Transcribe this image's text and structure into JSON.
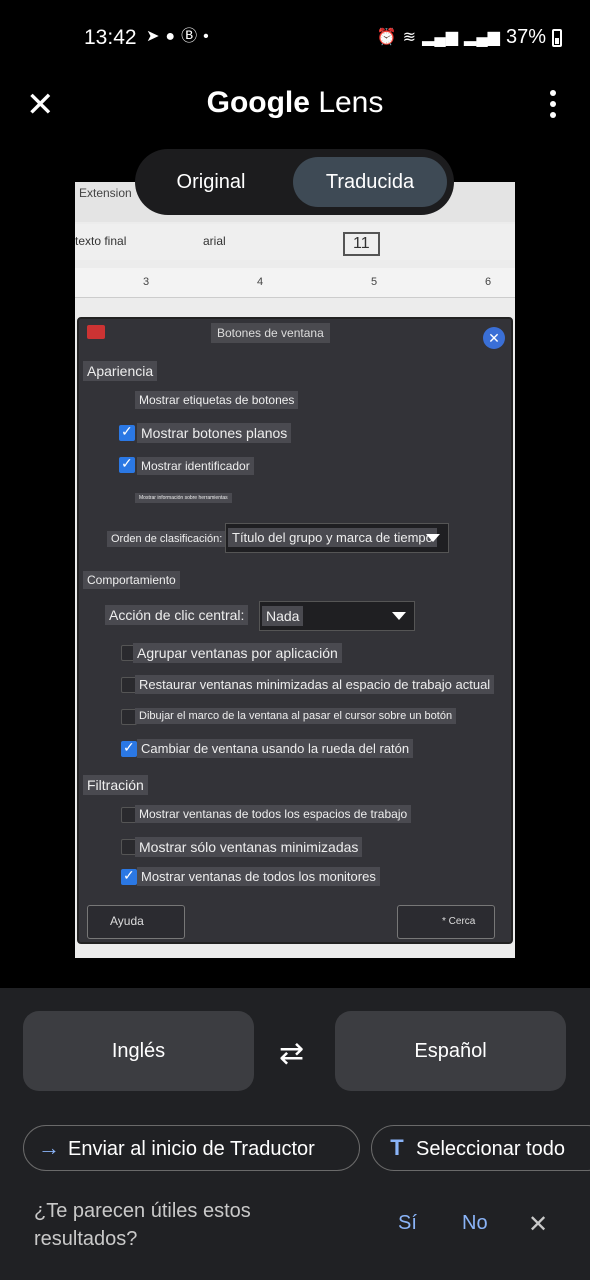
{
  "status_bar": {
    "time": "13:42",
    "battery": "37%",
    "left_icons": [
      "telegram-icon",
      "chat-icon",
      "b-icon",
      "dot-icon"
    ],
    "right_icons": [
      "alarm-icon",
      "wifi-icon",
      "signal-icon",
      "signal-icon",
      "battery-icon"
    ]
  },
  "header": {
    "title_brand": "Google",
    "title_product": "Lens"
  },
  "view_toggle": {
    "options": [
      "Original",
      "Traducida"
    ],
    "selected": "Traducida"
  },
  "photo": {
    "app_bar": {
      "extension_label": "Extension",
      "style_dropdown": "texto final",
      "font_dropdown": "arial",
      "font_size": "11",
      "ruler_ticks": [
        "3",
        "4",
        "5",
        "6"
      ]
    },
    "dialog": {
      "title": "Botones de ventana",
      "sections": {
        "appearance": "Apariencia",
        "behavior": "Comportamiento",
        "filtering": "Filtración"
      },
      "appearance_options": [
        {
          "label": "Mostrar etiquetas de botones"
        },
        {
          "label": "Mostrar botones planos",
          "checked": true
        },
        {
          "label": "Mostrar identificador",
          "checked": true
        },
        {
          "label": "Mostrar información sobre herramientas"
        }
      ],
      "sort_label": "Orden de clasificación:",
      "sort_value": "Título del grupo y marca de tiempo",
      "middle_click_label": "Acción de clic central:",
      "middle_click_value": "Nada",
      "behavior_options": [
        {
          "label": "Agrupar ventanas por aplicación",
          "checked": false
        },
        {
          "label": "Restaurar ventanas minimizadas al espacio de trabajo actual",
          "checked": false
        },
        {
          "label": "Dibujar el marco de la ventana al pasar el cursor sobre un botón",
          "checked": false
        },
        {
          "label": "Cambiar de ventana usando la rueda del ratón",
          "checked": true
        }
      ],
      "filter_options": [
        {
          "label": "Mostrar ventanas de todos los espacios de trabajo",
          "checked": false
        },
        {
          "label": "Mostrar sólo ventanas minimizadas",
          "checked": false
        },
        {
          "label": "Mostrar ventanas de todos los monitores",
          "checked": true
        }
      ],
      "help_button": "Ayuda",
      "close_button": "* Cerca"
    }
  },
  "languages": {
    "source": "Inglés",
    "target": "Español"
  },
  "actions": {
    "send_to_translate": "Enviar al inicio de Traductor",
    "select_all": "Seleccionar todo"
  },
  "feedback": {
    "question": "¿Te parecen útiles estos resultados?",
    "yes": "Sí",
    "no": "No"
  }
}
